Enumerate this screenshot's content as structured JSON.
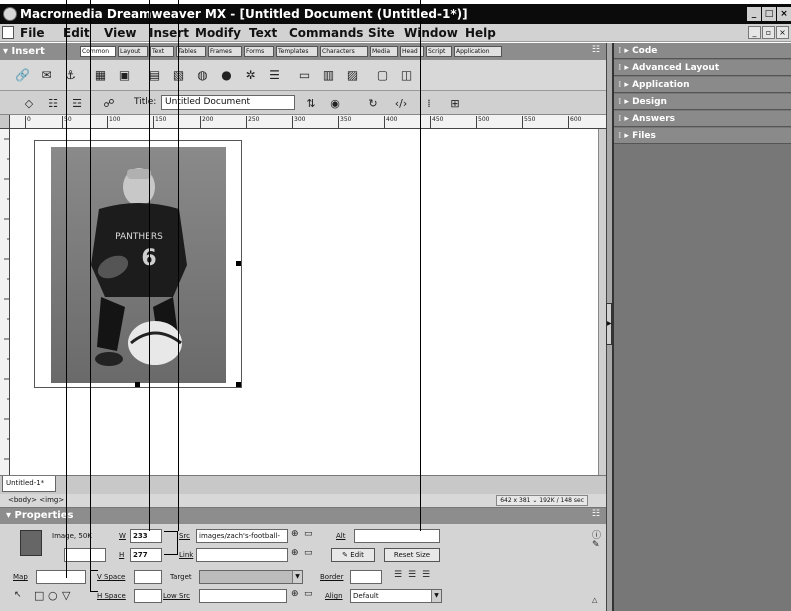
{
  "window": {
    "title": "Macromedia Dreamweaver MX - [Untitled Document (Untitled-1*)]",
    "controls": [
      "_",
      "□",
      "×"
    ],
    "mdi_controls": [
      "_",
      "▫",
      "×"
    ]
  },
  "menubar": {
    "items": [
      "File",
      "Edit",
      "View",
      "Insert",
      "Modify",
      "Text",
      "Commands",
      "Site",
      "Window",
      "Help"
    ]
  },
  "insert_panel": {
    "title": "▾ Insert",
    "tabs": [
      "Common",
      "Layout",
      "Text",
      "Tables",
      "Frames",
      "Forms",
      "Templates",
      "Characters",
      "Media",
      "Head",
      "Script",
      "Application"
    ],
    "active_tab": "Common"
  },
  "doc_toolbar": {
    "title_label": "Title:",
    "title_value": "Untitled Document"
  },
  "ruler": {
    "ticks": [
      "0",
      "50",
      "100",
      "150",
      "200",
      "250",
      "300",
      "350",
      "400",
      "450",
      "500",
      "550",
      "600"
    ]
  },
  "document": {
    "tab_label": "Untitled-1*",
    "tag_selector": "<body> <img>",
    "status": "642 x 381 ⌄  192K / 148 sec"
  },
  "properties": {
    "title": "▾ Properties",
    "image_label": "Image, 50K",
    "w_label": "W",
    "w_value": "233",
    "h_label": "H",
    "h_value": "277",
    "src_label": "Src",
    "src_value": "images/zach's-football-",
    "link_label": "Link",
    "link_value": "",
    "alt_label": "Alt",
    "alt_value": "",
    "edit_button": "Edit",
    "reset_size_button": "Reset Size",
    "map_label": "Map",
    "vspace_label": "V Space",
    "hspace_label": "H Space",
    "target_label": "Target",
    "lowsrc_label": "Low Src",
    "border_label": "Border",
    "align_label": "Align",
    "align_value": "Default"
  },
  "right_panels": [
    "Code",
    "Advanced Layout",
    "Application",
    "Design",
    "Answers",
    "Files"
  ],
  "colors": {
    "panel_header": "#8d8d8d",
    "right_background": "#777777",
    "title_bar": "#0b0b0b"
  }
}
